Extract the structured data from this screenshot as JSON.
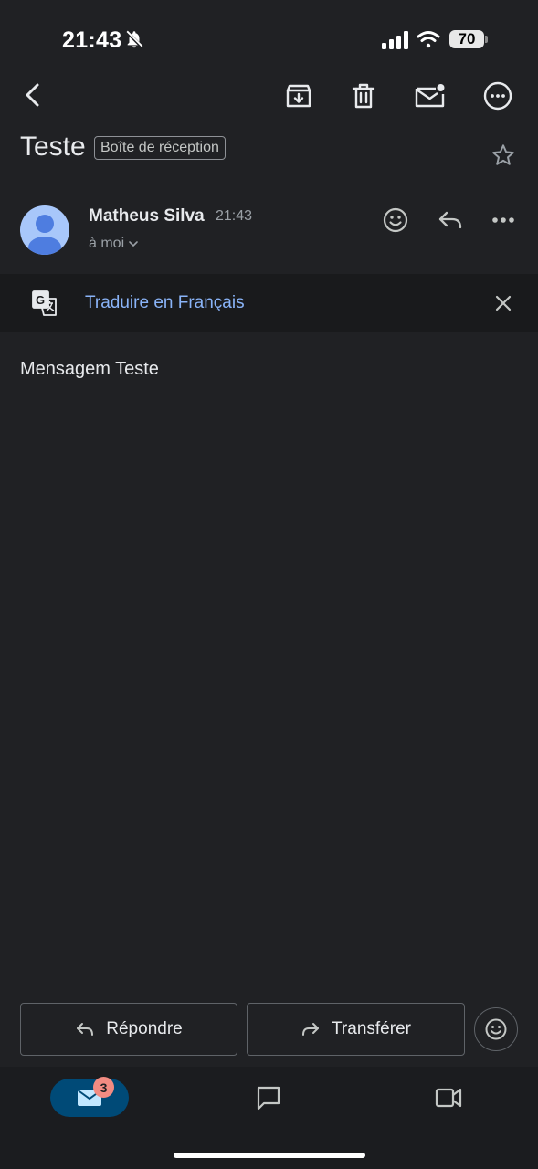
{
  "status_bar": {
    "time": "21:43",
    "battery": "70"
  },
  "toolbar": {
    "icons": [
      "back-arrow-icon",
      "archive-icon",
      "trash-icon",
      "mark-unread-icon",
      "more-circle-icon"
    ]
  },
  "email": {
    "subject": "Teste",
    "label": "Boîte de réception",
    "sender_name": "Matheus Silva",
    "time": "21:43",
    "recipients": "à moi",
    "body": "Mensagem Teste"
  },
  "translate": {
    "label": "Traduire en Français"
  },
  "actions": {
    "reply": "Répondre",
    "forward": "Transférer"
  },
  "bottom_nav": {
    "mail_badge": "3"
  },
  "colors": {
    "background": "#202124",
    "link": "#8ab4f8",
    "nav_active": "#004a77",
    "badge": "#f28b82"
  }
}
